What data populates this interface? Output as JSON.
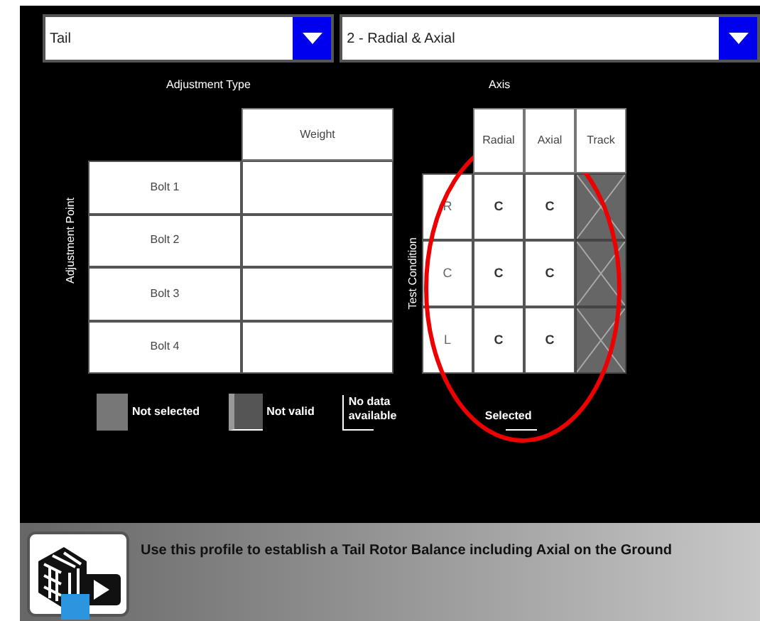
{
  "selectors": [
    {
      "value": "Tail"
    },
    {
      "value": "2 - Radial & Axial"
    }
  ],
  "adjustment_table": {
    "title": "Adjustment Type",
    "row_axis_label": "Adjustment Point",
    "column": "Weight",
    "rows": [
      {
        "label": "Bolt 1"
      },
      {
        "label": "Bolt 2"
      },
      {
        "label": "Bolt 3"
      },
      {
        "label": "Bolt 4"
      }
    ]
  },
  "axis_table": {
    "title": "Axis",
    "row_axis_label": "Test Condition",
    "columns": [
      {
        "label": "Radial"
      },
      {
        "label": "Axial"
      },
      {
        "label": "Track"
      }
    ],
    "rows": [
      {
        "label": "R",
        "cells": [
          {
            "kind": "value",
            "text": "C"
          },
          {
            "kind": "value",
            "text": "C"
          },
          {
            "kind": "not_valid"
          }
        ]
      },
      {
        "label": "C",
        "cells": [
          {
            "kind": "value",
            "text": "C"
          },
          {
            "kind": "value",
            "text": "C"
          },
          {
            "kind": "not_valid"
          }
        ]
      },
      {
        "label": "L",
        "cells": [
          {
            "kind": "value",
            "text": "C"
          },
          {
            "kind": "value",
            "text": "C"
          },
          {
            "kind": "not_valid"
          }
        ]
      }
    ]
  },
  "legend": [
    {
      "kind": "not_selected",
      "label": "Not selected"
    },
    {
      "kind": "not_valid",
      "label": "Not valid"
    },
    {
      "kind": "no_data",
      "label": "No data available"
    },
    {
      "kind": "selected",
      "label": "Selected"
    }
  ],
  "footer": {
    "description": "Use this profile to establish a Tail Rotor Balance including Axial on the Ground"
  }
}
